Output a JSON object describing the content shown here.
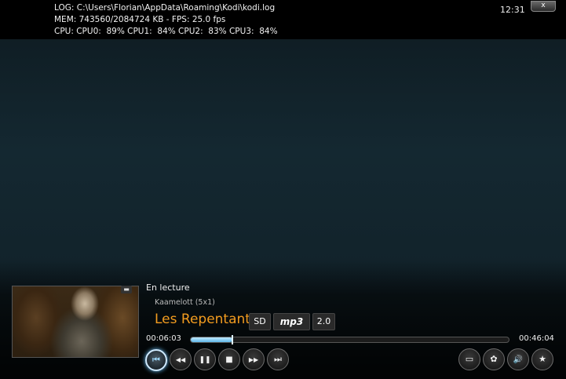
{
  "debug": {
    "log_line": "LOG: C:\\Users\\Florian\\AppData\\Roaming\\Kodi\\kodi.log",
    "mem_line": "MEM: 743560/2084724 KB - FPS: 25.0 fps",
    "cpu_line": "CPU: CPU0:  89% CPU1:  84% CPU2:  83% CPU3:  84%"
  },
  "clock": "12:31",
  "window": {
    "close_label": "x"
  },
  "now_playing": {
    "status": "En lecture",
    "episode": "Kaamelott (5x1)",
    "title": "Les Repentants",
    "flags": {
      "video": "SD",
      "audio_codec": "mp3",
      "channels": "2.0"
    }
  },
  "progress": {
    "elapsed": "00:06:03",
    "total": "00:46:04",
    "fraction": 0.131
  },
  "controls": {
    "previous": "⏮",
    "rewind": "◀◀",
    "pause": "❚❚",
    "stop": "■",
    "forward": "▶▶",
    "next": "⏭",
    "subtitles": "▭",
    "settings": "✿",
    "volume": "🔊",
    "bookmark": "★"
  },
  "accent_color": "#f39c1f"
}
